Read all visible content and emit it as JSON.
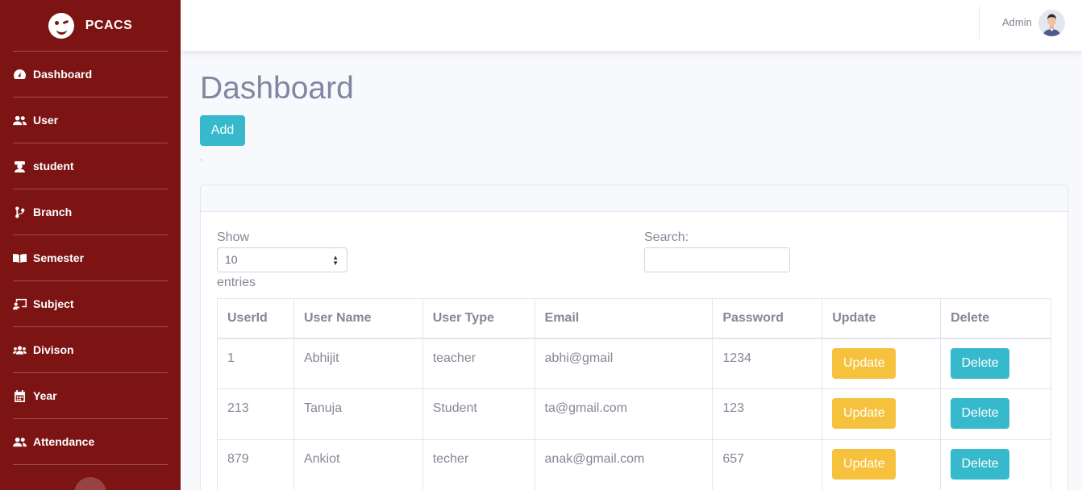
{
  "brand": {
    "name": "PCACS"
  },
  "sidebar": {
    "items": [
      {
        "label": "Dashboard",
        "icon": "tachometer-icon"
      },
      {
        "label": "User",
        "icon": "users-icon"
      },
      {
        "label": "student",
        "icon": "student-icon"
      },
      {
        "label": "Branch",
        "icon": "code-branch-icon"
      },
      {
        "label": "Semester",
        "icon": "book-open-icon"
      },
      {
        "label": "Subject",
        "icon": "chalkboard-icon"
      },
      {
        "label": "Divison",
        "icon": "users-group-icon"
      },
      {
        "label": "Year",
        "icon": "calendar-icon"
      },
      {
        "label": "Attendance",
        "icon": "users-icon"
      }
    ]
  },
  "topbar": {
    "user_name": "Admin"
  },
  "page": {
    "title": "Dashboard",
    "add_label": "Add",
    "dot": "."
  },
  "datatable": {
    "show_label": "Show",
    "length_value": "10",
    "entries_label": "entries",
    "search_label": "Search:",
    "search_value": "",
    "columns": [
      "UserId",
      "User Name",
      "User Type",
      "Email",
      "Password",
      "Update",
      "Delete"
    ],
    "rows": [
      {
        "id": "1",
        "name": "Abhijit",
        "type": "teacher",
        "email": "abhi@gmail",
        "password": "1234",
        "update": "Update",
        "delete": "Delete"
      },
      {
        "id": "213",
        "name": "Tanuja",
        "type": "Student",
        "email": "ta@gmail.com",
        "password": "123",
        "update": "Update",
        "delete": "Delete"
      },
      {
        "id": "879",
        "name": "Ankiot",
        "type": "techer",
        "email": "anak@gmail.com",
        "password": "657",
        "update": "Update",
        "delete": "Delete"
      }
    ]
  },
  "colors": {
    "sidebar": "#7d1414",
    "info": "#36b9cc",
    "warning": "#f6c23e",
    "text": "#858796"
  }
}
